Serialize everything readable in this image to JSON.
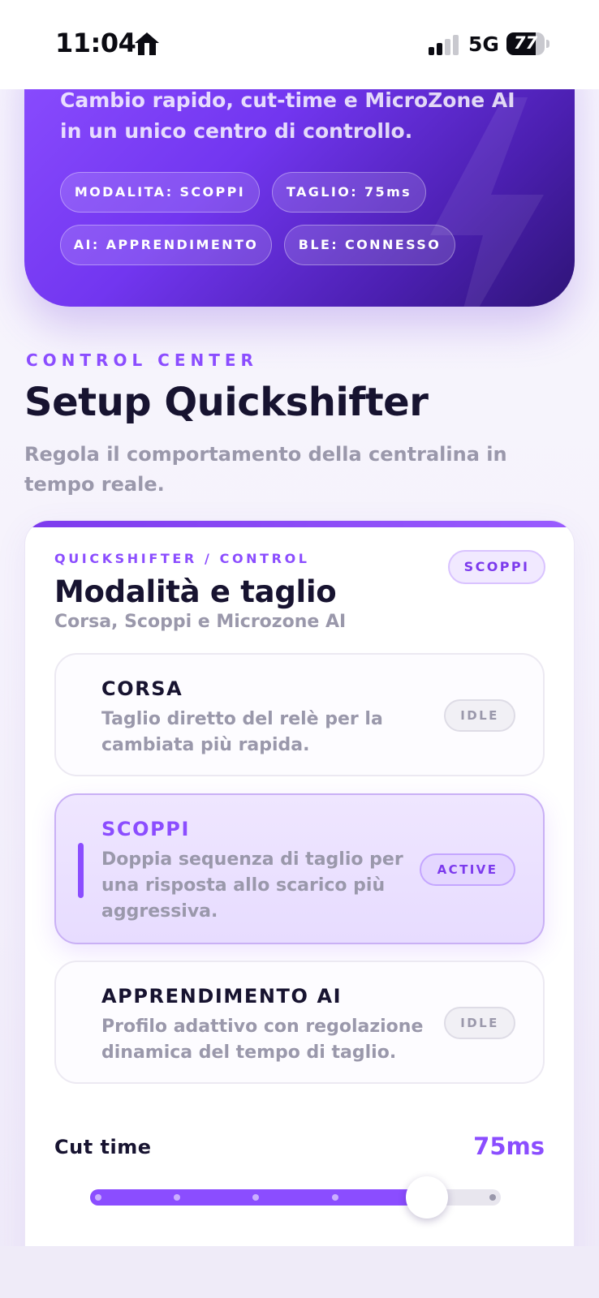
{
  "status_bar": {
    "time": "11:04",
    "network": "5G",
    "battery_level": 77,
    "battery_text": "77"
  },
  "hero": {
    "description": "Cambio rapido, cut-time e MicroZone AI in un unico centro di controllo.",
    "chips": [
      "MODALITA: SCOPPI",
      "TAGLIO: 75ms",
      "AI: APPRENDIMENTO",
      "BLE: CONNESSO"
    ]
  },
  "section": {
    "eyebrow": "CONTROL CENTER",
    "title": "Setup Quickshifter",
    "subtitle": "Regola il comportamento della centralina in tempo reale."
  },
  "panel": {
    "eyebrow": "QUICKSHIFTER / CONTROL",
    "badge": "SCOPPI",
    "title": "Modalità e taglio",
    "subtitle": "Corsa, Scoppi e Microzone AI",
    "modes": [
      {
        "name": "CORSA",
        "description": "Taglio diretto del relè per la cambiata più rapida.",
        "status": "IDLE",
        "active": false
      },
      {
        "name": "SCOPPI",
        "description": "Doppia sequenza di taglio per una risposta allo scarico più aggressiva.",
        "status": "ACTIVE",
        "active": true
      },
      {
        "name": "APPRENDIMENTO AI",
        "description": "Profilo adattivo con regolazione dinamica del tempo di taglio.",
        "status": "IDLE",
        "active": false
      }
    ],
    "cut_time": {
      "label": "Cut time",
      "value": "75ms",
      "slider_fraction": 0.82,
      "ticks": 6
    }
  },
  "colors": {
    "accent": "#8b4dff",
    "text": "#171330",
    "muted": "#9a98ab"
  }
}
